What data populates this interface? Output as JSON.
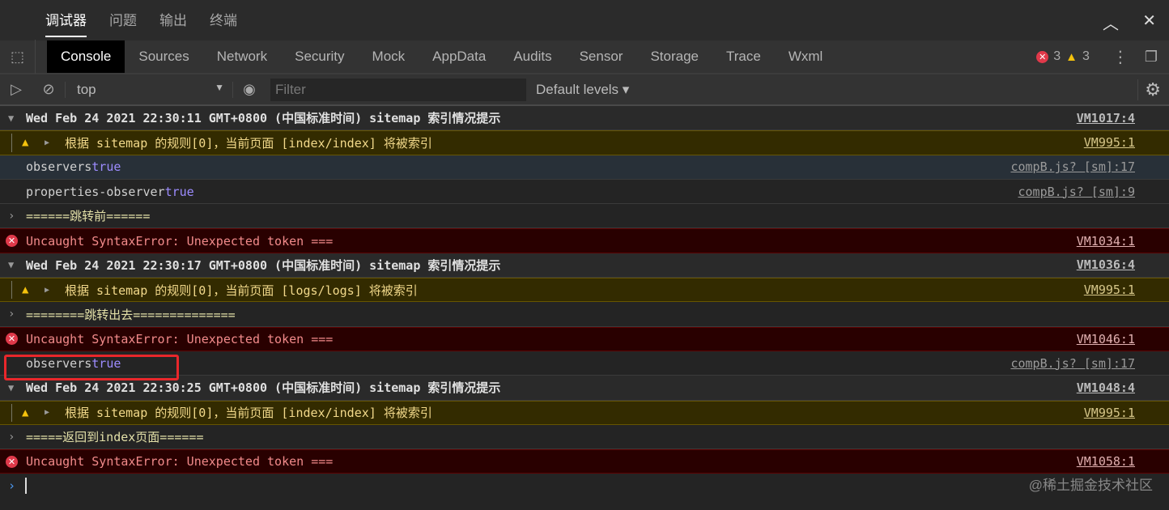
{
  "top_tabs": [
    "调试器",
    "问题",
    "输出",
    "终端"
  ],
  "devtools_tabs": [
    "Console",
    "Sources",
    "Network",
    "Security",
    "Mock",
    "AppData",
    "Audits",
    "Sensor",
    "Storage",
    "Trace",
    "Wxml"
  ],
  "counts": {
    "errors": "3",
    "warnings": "3"
  },
  "toolbar": {
    "context": "top",
    "filter_placeholder": "Filter",
    "levels": "Default levels ▾"
  },
  "logs": [
    {
      "type": "group",
      "text": "Wed Feb 24 2021 22:30:11 GMT+0800 (中国标准时间) sitemap 索引情况提示",
      "src": "VM1017:4"
    },
    {
      "type": "warn",
      "text": "根据 sitemap 的规则[0]，当前页面 [index/index] 将被索引",
      "src": "VM995:1"
    },
    {
      "type": "log",
      "key": "observers",
      "val": "true",
      "src": "compB.js? [sm]:17",
      "hl": true
    },
    {
      "type": "log",
      "key": "properties-observer",
      "val": "true",
      "src": "compB.js? [sm]:9"
    },
    {
      "type": "out",
      "text": "======跳转前======"
    },
    {
      "type": "error",
      "text": "Uncaught SyntaxError: Unexpected token ===",
      "src": "VM1034:1"
    },
    {
      "type": "group",
      "text": "Wed Feb 24 2021 22:30:17 GMT+0800 (中国标准时间) sitemap 索引情况提示",
      "src": "VM1036:4"
    },
    {
      "type": "warn",
      "text": "根据 sitemap 的规则[0]，当前页面 [logs/logs] 将被索引",
      "src": "VM995:1"
    },
    {
      "type": "out",
      "text": "========跳转出去=============="
    },
    {
      "type": "error",
      "text": "Uncaught SyntaxError: Unexpected token ===",
      "src": "VM1046:1"
    },
    {
      "type": "log",
      "key": "observers",
      "val": "true",
      "src": "compB.js? [sm]:17"
    },
    {
      "type": "group",
      "text": "Wed Feb 24 2021 22:30:25 GMT+0800 (中国标准时间) sitemap 索引情况提示",
      "src": "VM1048:4"
    },
    {
      "type": "warn",
      "text": "根据 sitemap 的规则[0]，当前页面 [index/index] 将被索引",
      "src": "VM995:1"
    },
    {
      "type": "out",
      "text": "=====返回到index页面======"
    },
    {
      "type": "error",
      "text": "Uncaught SyntaxError: Unexpected token ===",
      "src": "VM1058:1"
    }
  ],
  "watermark": "@稀土掘金技术社区"
}
